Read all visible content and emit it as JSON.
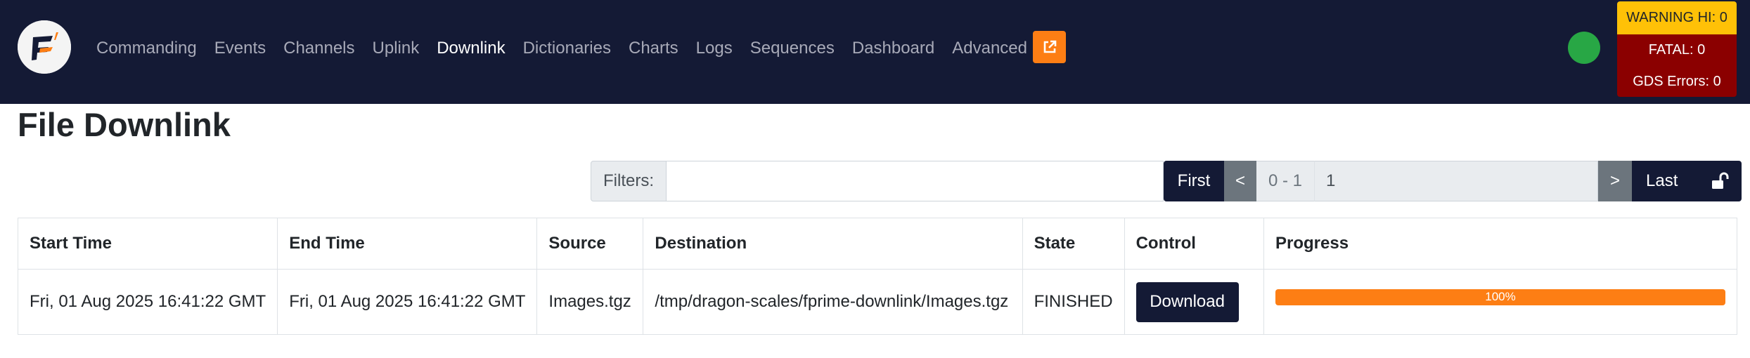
{
  "navbar": {
    "links": [
      {
        "label": "Commanding",
        "active": false
      },
      {
        "label": "Events",
        "active": false
      },
      {
        "label": "Channels",
        "active": false
      },
      {
        "label": "Uplink",
        "active": false
      },
      {
        "label": "Downlink",
        "active": true
      },
      {
        "label": "Dictionaries",
        "active": false
      },
      {
        "label": "Charts",
        "active": false
      },
      {
        "label": "Logs",
        "active": false
      },
      {
        "label": "Sequences",
        "active": false
      },
      {
        "label": "Dashboard",
        "active": false
      },
      {
        "label": "Advanced",
        "active": false
      }
    ],
    "external_link_icon": "external-link-icon",
    "status_color": "#28a745",
    "alerts": {
      "warning_hi": "WARNING HI: 0",
      "fatal": "FATAL: 0",
      "gds_errors": "GDS Errors: 0"
    }
  },
  "page": {
    "title": "File Downlink"
  },
  "filters": {
    "label": "Filters:",
    "value": "",
    "placeholder": ""
  },
  "pager": {
    "first": "First",
    "prev": "<",
    "range": "0 - 1",
    "page": "1",
    "next": ">",
    "last": "Last",
    "lock_icon": "unlock-icon"
  },
  "table": {
    "headers": [
      "Start Time",
      "End Time",
      "Source",
      "Destination",
      "State",
      "Control",
      "Progress"
    ],
    "rows": [
      {
        "start_time": "Fri, 01 Aug 2025 16:41:22 GMT",
        "end_time": "Fri, 01 Aug 2025 16:41:22 GMT",
        "source": "Images.tgz",
        "destination": "/tmp/dragon-scales/fprime-downlink/Images.tgz",
        "state": "FINISHED",
        "control": "Download",
        "progress_label": "100%",
        "progress": 1.0
      }
    ]
  },
  "colors": {
    "navbar_bg": "#141a35",
    "accent": "#fd7e14",
    "warning": "#ffc107",
    "fatal": "#8b0000"
  }
}
